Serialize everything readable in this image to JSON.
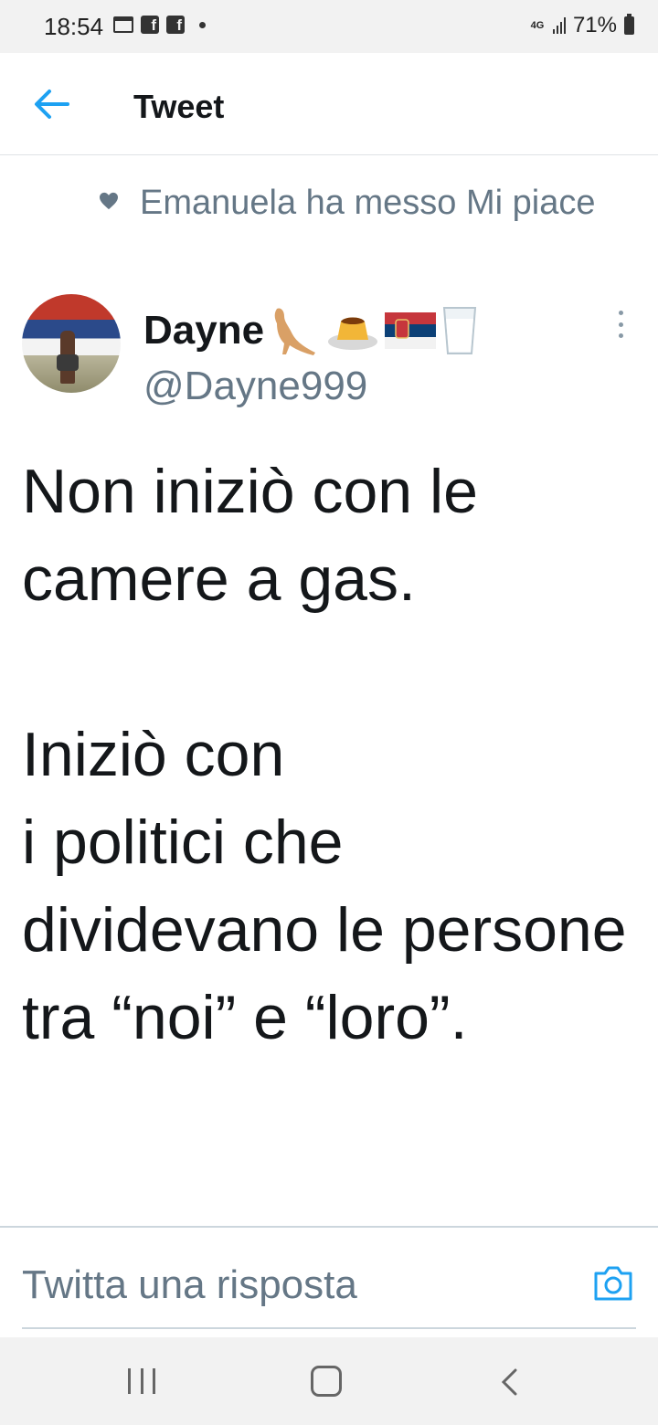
{
  "status_bar": {
    "time": "18:54",
    "network": "4G",
    "battery": "71%"
  },
  "header": {
    "title": "Tweet"
  },
  "social_context": {
    "text": "Emanuela ha messo Mi piace"
  },
  "author": {
    "name": "Dayne",
    "handle": "@Dayne999",
    "emojis": [
      "kangaroo-emoji",
      "custard-emoji",
      "serbia-flag-emoji",
      "glass-of-milk-emoji"
    ]
  },
  "tweet": {
    "text": "Non iniziò con le camere a gas.\n\nIniziò con\ni politici che dividevano le persone tra “noi” e “loro”."
  },
  "reply_bar": {
    "placeholder": "Twitta una risposta"
  },
  "colors": {
    "accent": "#1da1f2",
    "secondary_text": "#657786",
    "primary_text": "#14171a"
  }
}
